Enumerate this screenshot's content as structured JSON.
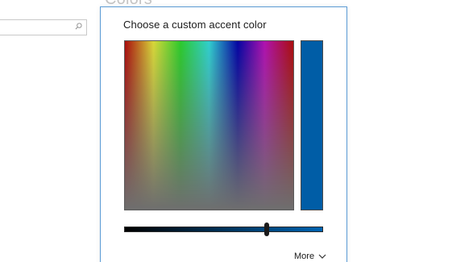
{
  "background_page": {
    "title": "Colors",
    "search": {
      "placeholder": "",
      "icon": "search-icon"
    }
  },
  "dialog": {
    "title": "Choose a custom accent color",
    "preview_color": "#005da6",
    "accent_color": "#0063b1",
    "brightness_level": 0.72,
    "more_label": "More",
    "more_icon": "chevron-down-icon"
  }
}
